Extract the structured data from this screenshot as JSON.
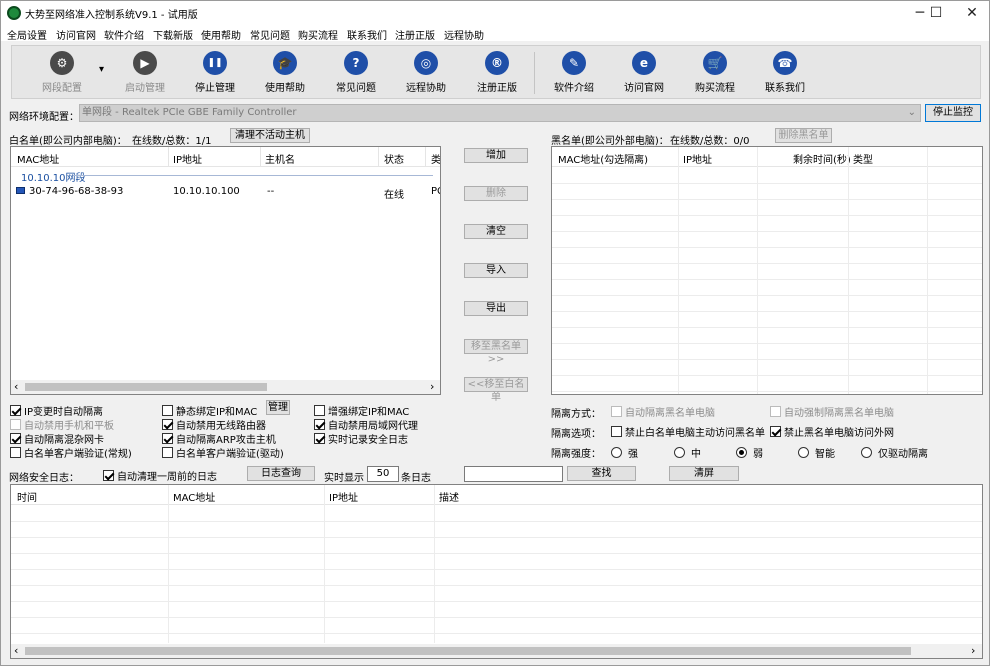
{
  "window": {
    "title": "大势至网络准入控制系统V9.1 - 试用版",
    "minimize": "─",
    "maximize": "☐",
    "close": "✕"
  },
  "menu": [
    "全局设置",
    "访问官网",
    "软件介绍",
    "下载新版",
    "使用帮助",
    "常见问题",
    "购买流程",
    "联系我们",
    "注册正版",
    "远程协助"
  ],
  "toolbar": {
    "config": "网段配置",
    "config_arrow": "▾",
    "start": "启动管理",
    "stop": "停止管理",
    "help": "使用帮助",
    "faq": "常见问题",
    "remote": "远程协助",
    "register": "注册正版",
    "intro": "软件介绍",
    "website": "访问官网",
    "buy": "购买流程",
    "contact": "联系我们",
    "glyphs": {
      "config": "⚙",
      "start": "▶",
      "stop": "❚❚",
      "help": "🎓",
      "faq": "?",
      "remote": "◎",
      "register": "®",
      "intro": "✎",
      "website": "e",
      "buy": "🛒",
      "contact": "☎"
    }
  },
  "network": {
    "label": "网络环境配置：",
    "value": "单网段 - Realtek PCIe GBE Family Controller",
    "arrow": "⌄",
    "stop_button": "停止监控"
  },
  "whitelist": {
    "title": "白名单(即公司内部电脑)：",
    "count_label": "在线数/总数：1/1",
    "clean_button": "清理不活动主机",
    "columns": [
      "MAC地址",
      "IP地址",
      "主机名",
      "状态",
      "类"
    ],
    "group": "10.10.10网段",
    "rows": [
      {
        "mac": "30-74-96-68-38-93",
        "ip": "10.10.10.100",
        "host": "--",
        "status": "在线",
        "type": "PC"
      }
    ]
  },
  "middle_buttons": {
    "add": "增加",
    "delete": "删除",
    "clear": "清空",
    "import": "导入",
    "export": "导出",
    "to_black": "移至黑名单>>",
    "to_white": "<<移至白名单"
  },
  "blacklist": {
    "title": "黑名单(即公司外部电脑)：",
    "count_label": "在线数/总数：0/0",
    "delete_button": "删除黑名单",
    "columns": [
      "MAC地址(勾选隔离)",
      "IP地址",
      "剩余时间(秒)",
      "类型"
    ]
  },
  "options": {
    "ip_change_isolate": "IP变更时自动隔离",
    "static_bind": "静态绑定IP和MAC",
    "manage": "管理",
    "enhanced_bind": "增强绑定IP和MAC",
    "disable_mobile": "自动禁用手机和平板",
    "disable_wireless": "自动禁用无线路由器",
    "disable_proxy": "自动禁用局域网代理",
    "isolate_promisc": "自动隔离混杂网卡",
    "isolate_arp": "自动隔离ARP攻击主机",
    "realtime_log": "实时记录安全日志",
    "client_auth_normal": "白名单客户端验证(常规)",
    "client_auth_driver": "白名单客户端验证(驱动)"
  },
  "isolation": {
    "method_label": "隔离方式：",
    "auto_isolate_black": "自动隔离黑名单电脑",
    "force_isolate_black": "自动强制隔离黑名单电脑",
    "option_label": "隔离选项：",
    "forbid_white_access": "禁止白名单电脑主动访问黑名单",
    "forbid_black_internet": "禁止黑名单电脑访问外网",
    "strength_label": "隔离强度：",
    "strengths": [
      "强",
      "中",
      "弱",
      "智能",
      "仅驱动隔离"
    ]
  },
  "log": {
    "label": "网络安全日志：",
    "auto_clean": "自动清理一周前的日志",
    "query_button": "日志查询",
    "realtime_show": "实时显示",
    "count": "50",
    "unit": "条日志",
    "search_value": "",
    "find_button": "查找",
    "clear_button": "清屏",
    "columns": [
      "时间",
      "MAC地址",
      "IP地址",
      "描述"
    ]
  },
  "scroll": {
    "left": "‹",
    "right": "›"
  }
}
